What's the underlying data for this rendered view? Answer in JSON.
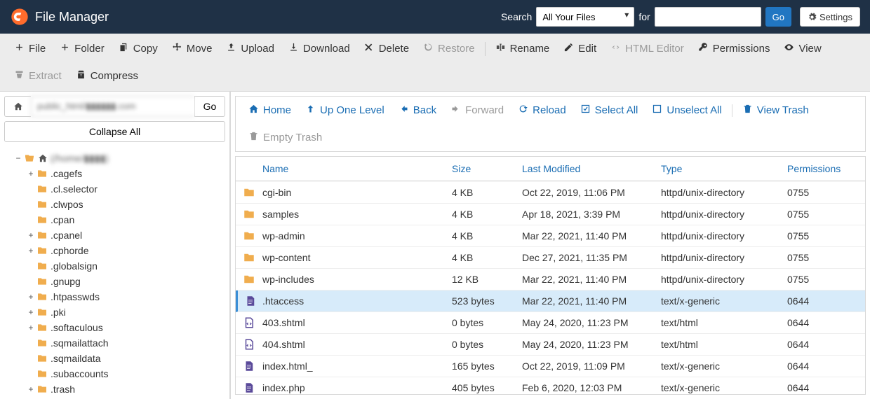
{
  "header": {
    "title": "File Manager",
    "search_label": "Search",
    "for_label": "for",
    "select_value": "All Your Files",
    "go_label": "Go",
    "settings_label": "Settings"
  },
  "toolbar": [
    {
      "icon": "plus",
      "label": "File",
      "disabled": false,
      "name": "new-file-button"
    },
    {
      "icon": "plus",
      "label": "Folder",
      "disabled": false,
      "name": "new-folder-button"
    },
    {
      "icon": "copy",
      "label": "Copy",
      "disabled": false,
      "name": "copy-button"
    },
    {
      "icon": "move",
      "label": "Move",
      "disabled": false,
      "name": "move-button"
    },
    {
      "icon": "upload",
      "label": "Upload",
      "disabled": false,
      "name": "upload-button"
    },
    {
      "icon": "download",
      "label": "Download",
      "disabled": false,
      "name": "download-button"
    },
    {
      "icon": "x",
      "label": "Delete",
      "disabled": false,
      "name": "delete-button"
    },
    {
      "icon": "restore",
      "label": "Restore",
      "disabled": true,
      "name": "restore-button"
    },
    {
      "sep": true
    },
    {
      "icon": "rename",
      "label": "Rename",
      "disabled": false,
      "name": "rename-button"
    },
    {
      "icon": "edit",
      "label": "Edit",
      "disabled": false,
      "name": "edit-button"
    },
    {
      "icon": "html",
      "label": "HTML Editor",
      "disabled": true,
      "name": "html-editor-button"
    },
    {
      "icon": "key",
      "label": "Permissions",
      "disabled": false,
      "name": "permissions-button"
    },
    {
      "icon": "eye",
      "label": "View",
      "disabled": false,
      "name": "view-button"
    },
    {
      "break": true
    },
    {
      "icon": "extract",
      "label": "Extract",
      "disabled": true,
      "name": "extract-button"
    },
    {
      "icon": "compress",
      "label": "Compress",
      "disabled": false,
      "name": "compress-button"
    }
  ],
  "sidebar": {
    "path_value": "public_html/▮▮▮▮▮▮.com",
    "go_label": "Go",
    "collapse_label": "Collapse All",
    "root_label": "(/home/▮▮▮▮)",
    "nodes": [
      {
        "label": ".cagefs",
        "expandable": true,
        "icon": "folder"
      },
      {
        "label": ".cl.selector",
        "expandable": false,
        "icon": "folder"
      },
      {
        "label": ".clwpos",
        "expandable": false,
        "icon": "folder"
      },
      {
        "label": ".cpan",
        "expandable": false,
        "icon": "folder"
      },
      {
        "label": ".cpanel",
        "expandable": true,
        "icon": "folder"
      },
      {
        "label": ".cphorde",
        "expandable": true,
        "icon": "folder"
      },
      {
        "label": ".globalsign",
        "expandable": false,
        "icon": "folder"
      },
      {
        "label": ".gnupg",
        "expandable": false,
        "icon": "folder"
      },
      {
        "label": ".htpasswds",
        "expandable": true,
        "icon": "folder"
      },
      {
        "label": ".pki",
        "expandable": true,
        "icon": "folder"
      },
      {
        "label": ".softaculous",
        "expandable": true,
        "icon": "folder"
      },
      {
        "label": ".sqmailattach",
        "expandable": false,
        "icon": "folder"
      },
      {
        "label": ".sqmaildata",
        "expandable": false,
        "icon": "folder"
      },
      {
        "label": ".subaccounts",
        "expandable": false,
        "icon": "folder"
      },
      {
        "label": ".trash",
        "expandable": true,
        "icon": "folder"
      }
    ]
  },
  "actions": [
    {
      "icon": "home",
      "label": "Home",
      "disabled": false,
      "name": "home-button"
    },
    {
      "icon": "up",
      "label": "Up One Level",
      "disabled": false,
      "name": "up-level-button"
    },
    {
      "icon": "back",
      "label": "Back",
      "disabled": false,
      "name": "back-button"
    },
    {
      "icon": "forward",
      "label": "Forward",
      "disabled": true,
      "name": "forward-button"
    },
    {
      "icon": "reload",
      "label": "Reload",
      "disabled": false,
      "name": "reload-button"
    },
    {
      "icon": "selectall",
      "label": "Select All",
      "disabled": false,
      "name": "select-all-button"
    },
    {
      "icon": "unselect",
      "label": "Unselect All",
      "disabled": false,
      "name": "unselect-all-button"
    },
    {
      "sep": true
    },
    {
      "icon": "trash",
      "label": "View Trash",
      "disabled": false,
      "name": "view-trash-button"
    },
    {
      "break": true
    },
    {
      "icon": "emptytrash",
      "label": "Empty Trash",
      "disabled": true,
      "name": "empty-trash-button"
    }
  ],
  "columns": {
    "name": "Name",
    "size": "Size",
    "modified": "Last Modified",
    "type": "Type",
    "permissions": "Permissions"
  },
  "rows": [
    {
      "icon": "folder",
      "name": "cgi-bin",
      "size": "4 KB",
      "modified": "Oct 22, 2019, 11:06 PM",
      "type": "httpd/unix-directory",
      "perm": "0755",
      "selected": false
    },
    {
      "icon": "folder",
      "name": "samples",
      "size": "4 KB",
      "modified": "Apr 18, 2021, 3:39 PM",
      "type": "httpd/unix-directory",
      "perm": "0755",
      "selected": false
    },
    {
      "icon": "folder",
      "name": "wp-admin",
      "size": "4 KB",
      "modified": "Mar 22, 2021, 11:40 PM",
      "type": "httpd/unix-directory",
      "perm": "0755",
      "selected": false
    },
    {
      "icon": "folder",
      "name": "wp-content",
      "size": "4 KB",
      "modified": "Dec 27, 2021, 11:35 PM",
      "type": "httpd/unix-directory",
      "perm": "0755",
      "selected": false
    },
    {
      "icon": "folder",
      "name": "wp-includes",
      "size": "12 KB",
      "modified": "Mar 22, 2021, 11:40 PM",
      "type": "httpd/unix-directory",
      "perm": "0755",
      "selected": false
    },
    {
      "icon": "file",
      "name": ".htaccess",
      "size": "523 bytes",
      "modified": "Mar 22, 2021, 11:40 PM",
      "type": "text/x-generic",
      "perm": "0644",
      "selected": true
    },
    {
      "icon": "file-code",
      "name": "403.shtml",
      "size": "0 bytes",
      "modified": "May 24, 2020, 11:23 PM",
      "type": "text/html",
      "perm": "0644",
      "selected": false
    },
    {
      "icon": "file-code",
      "name": "404.shtml",
      "size": "0 bytes",
      "modified": "May 24, 2020, 11:23 PM",
      "type": "text/html",
      "perm": "0644",
      "selected": false
    },
    {
      "icon": "file",
      "name": "index.html_",
      "size": "165 bytes",
      "modified": "Oct 22, 2019, 11:09 PM",
      "type": "text/x-generic",
      "perm": "0644",
      "selected": false
    },
    {
      "icon": "file",
      "name": "index.php",
      "size": "405 bytes",
      "modified": "Feb 6, 2020, 12:03 PM",
      "type": "text/x-generic",
      "perm": "0644",
      "selected": false
    }
  ]
}
